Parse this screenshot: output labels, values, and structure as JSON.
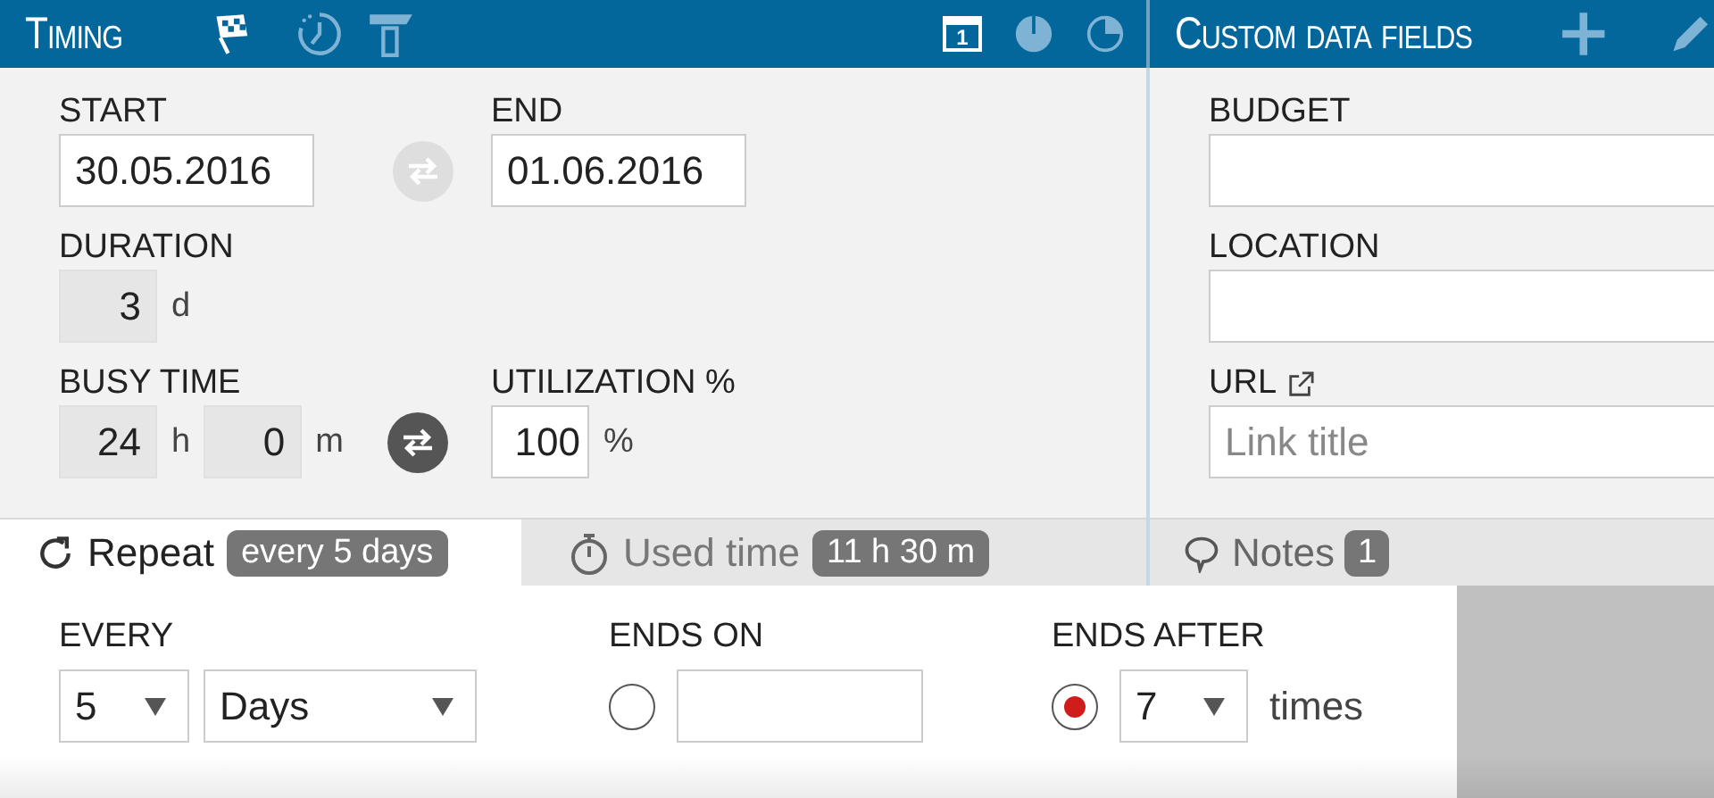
{
  "timing": {
    "title": "Timing",
    "view_buttons": [
      {
        "kind": "calendar",
        "label": "1"
      },
      {
        "kind": "pie-full"
      },
      {
        "kind": "pie-quarter"
      }
    ],
    "start": {
      "label": "START",
      "value": "30.05.2016"
    },
    "swap_dates": {
      "disabled": true
    },
    "end": {
      "label": "END",
      "value": "01.06.2016"
    },
    "duration": {
      "label": "DURATION",
      "value": "3",
      "unit": "d"
    },
    "busy_time": {
      "label": "BUSY TIME",
      "hours": "24",
      "hours_unit": "h",
      "minutes": "0",
      "minutes_unit": "m"
    },
    "swap_busy": {
      "disabled": false
    },
    "utilization": {
      "label": "UTILIZATION %",
      "value": "100",
      "unit": "%"
    }
  },
  "custom_data_fields": {
    "title": "Custom data fields",
    "fields": [
      {
        "kind": "text",
        "label": "BUDGET"
      },
      {
        "kind": "text",
        "label": "LOCATION"
      },
      {
        "kind": "link",
        "label": "URL",
        "placeholder": "Link title"
      }
    ]
  },
  "tabs": [
    {
      "kind": "repeat",
      "label": "Repeat",
      "badge": "every 5 days",
      "selected": true
    },
    {
      "kind": "used-time",
      "label": "Used time",
      "badge": "11 h 30 m",
      "selected": false
    }
  ],
  "notes_tab": {
    "label": "Notes",
    "badge": "1"
  },
  "repeat": {
    "every": {
      "label": "EVERY",
      "count": "5",
      "unit": "Days"
    },
    "ends_on": {
      "label": "ENDS ON",
      "selected": false
    },
    "ends_after": {
      "label": "ENDS AFTER",
      "selected": true,
      "count": "7",
      "unit": "times"
    }
  }
}
